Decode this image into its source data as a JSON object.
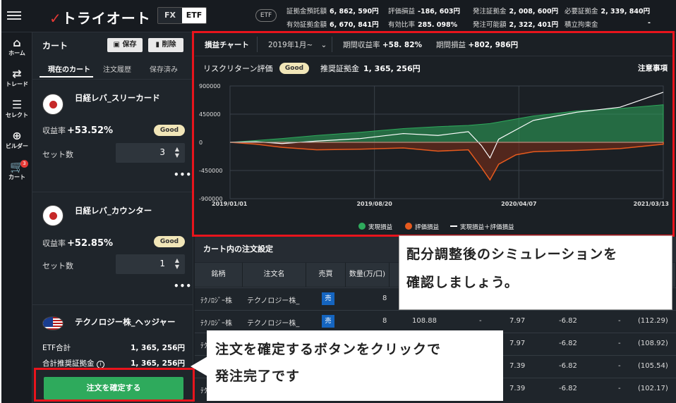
{
  "header": {
    "brand": "トライオート",
    "mode_tabs": [
      "FX",
      "ETF"
    ],
    "active_mode": "ETF",
    "badge": "ETF",
    "stats": [
      {
        "label": "証拠金預託額",
        "value": "6, 862, 590円"
      },
      {
        "label": "評価損益",
        "value": "-186, 603円"
      },
      {
        "label": "発注証拠金",
        "value": "2, 008, 600円"
      },
      {
        "label": "必要証拠金",
        "value": "2, 339, 840円"
      },
      {
        "label": "有効証拠金額",
        "value": "6, 670, 841円"
      },
      {
        "label": "有効比率",
        "value": "285. 098%"
      },
      {
        "label": "発注可能額",
        "value": "2, 322, 401円"
      },
      {
        "label": "積立拘束金",
        "value": "-"
      }
    ]
  },
  "nav": {
    "items": [
      {
        "label": "ホーム",
        "icon": "home-icon"
      },
      {
        "label": "トレード",
        "icon": "trade-arrows-icon"
      },
      {
        "label": "セレクト",
        "icon": "select-list-icon"
      },
      {
        "label": "ビルダー",
        "icon": "plus-circle-icon"
      },
      {
        "label": "カート",
        "icon": "cart-icon"
      }
    ],
    "cart_count": "3"
  },
  "cart": {
    "title": "カート",
    "save_label": "保存",
    "delete_label": "削除",
    "tabs": [
      "現在のカート",
      "注文履歴",
      "保存済み"
    ],
    "items": [
      {
        "name": "日経レバ_スリーカード",
        "return_label": "収益率",
        "return_value": "+53.52%",
        "rating": "Good",
        "set_label": "セット数",
        "sets": "3",
        "flag": "jp-flag-icon"
      },
      {
        "name": "日経レバ_カウンター",
        "return_label": "収益率",
        "return_value": "+52.85%",
        "rating": "Good",
        "set_label": "セット数",
        "sets": "1",
        "flag": "jp-flag-icon"
      },
      {
        "name": "テクノロジー株_ヘッジャー",
        "flag": "us-flag-icon"
      }
    ],
    "etf_total_label": "ETF合計",
    "etf_total_value": "1, 365, 256円",
    "margin_total_label": "合計推奨証拠金",
    "margin_total_value": "1, 365, 256円",
    "confirm_label": "注文を確定する"
  },
  "chart_panel": {
    "tab_label": "損益チャート",
    "period_label": "2019年1月~",
    "period_return_label": "期間収益率",
    "period_return_value": "+58. 82%",
    "period_pl_label": "期間損益",
    "period_pl_value": "+802, 986円",
    "risk_label": "リスクリターン評価",
    "risk_rating": "Good",
    "required_margin_label": "推奨証拠金",
    "required_margin_value": "1, 365, 256円",
    "notice_label": "注意事項"
  },
  "chart_data": {
    "type": "area",
    "x_ticks": [
      "2019/01/01",
      "2019/08/20",
      "2020/04/07",
      "2021/03/13"
    ],
    "y_ticks": [
      900000,
      450000,
      0,
      -450000,
      -900000
    ],
    "y_tick_labels": [
      "900000",
      "450000",
      "0",
      "-450000",
      "-900000"
    ],
    "ylim": [
      -900000,
      900000
    ],
    "grid": true,
    "legend_position": "bottom",
    "series": [
      {
        "name": "実現損益",
        "color": "#2eaa5c",
        "x": [
          0,
          0.06,
          0.12,
          0.2,
          0.3,
          0.4,
          0.48,
          0.55,
          0.6,
          0.7,
          0.8,
          0.9,
          1.0
        ],
        "values": [
          0,
          30000,
          60000,
          110000,
          160000,
          220000,
          250000,
          270000,
          300000,
          420000,
          500000,
          540000,
          600000
        ]
      },
      {
        "name": "評価損益",
        "color": "#e65a1e",
        "x": [
          0,
          0.06,
          0.12,
          0.2,
          0.3,
          0.4,
          0.48,
          0.55,
          0.58,
          0.6,
          0.62,
          0.66,
          0.7,
          0.8,
          0.9,
          1.0
        ],
        "values": [
          0,
          -30000,
          -80000,
          -120000,
          -110000,
          -90000,
          -140000,
          -120000,
          -400000,
          -600000,
          -350000,
          -200000,
          -150000,
          -130000,
          -100000,
          -30000
        ]
      },
      {
        "name": "実現損益＋評価損益",
        "color": "#ffffff",
        "x": [
          0,
          0.06,
          0.12,
          0.2,
          0.3,
          0.4,
          0.48,
          0.55,
          0.58,
          0.6,
          0.62,
          0.66,
          0.7,
          0.8,
          0.9,
          1.0
        ],
        "values": [
          0,
          10000,
          -20000,
          20000,
          60000,
          140000,
          110000,
          170000,
          -50000,
          -250000,
          50000,
          200000,
          350000,
          480000,
          560000,
          800000
        ]
      }
    ]
  },
  "orders": {
    "title": "カート内の注文設定",
    "columns": [
      "銘柄",
      "注文名",
      "売買",
      "数量(万/口)"
    ],
    "rows": [
      {
        "symbol": "ﾃｸﾉﾛｼﾞｰ株",
        "name": "テクノロジー株_",
        "side": "売",
        "qty": "8",
        "price": "",
        "c1": "",
        "c2": "",
        "c3": "",
        "c4": "",
        "c5": ""
      },
      {
        "symbol": "ﾃｸﾉﾛｼﾞｰ株",
        "name": "テクノロジー株_",
        "side": "売",
        "qty": "8",
        "price": "108.88",
        "c1": "-",
        "c2": "7.97",
        "c3": "-6.82",
        "c4": "-",
        "c5": "(112.29)"
      },
      {
        "symbol": "ﾃｸ",
        "name": "",
        "side": "",
        "qty": "",
        "price": "",
        "c1": "",
        "c2": "7.97",
        "c3": "-6.82",
        "c4": "-",
        "c5": "(108.92)"
      },
      {
        "symbol": "ﾃｸ",
        "name": "",
        "side": "",
        "qty": "",
        "price": "",
        "c1": "",
        "c2": "7.39",
        "c3": "-6.82",
        "c4": "-",
        "c5": "(105.54)"
      },
      {
        "symbol": "ﾃｸ",
        "name": "",
        "side": "",
        "qty": "",
        "price": "",
        "c1": "",
        "c2": "7.39",
        "c3": "-6.82",
        "c4": "-",
        "c5": "(102.17)"
      }
    ]
  },
  "callouts": {
    "top_line1": "配分調整後のシミュレーションを",
    "top_line2": "確認しましょう。",
    "bottom_line1": "注文を確定するボタンをクリックで",
    "bottom_line2": "発注完了です"
  },
  "colors": {
    "accent_red": "#e8141c",
    "good_badge": "#f1e6b8",
    "confirm_green": "#2eaa5c",
    "sell_blue": "#1565c0"
  }
}
